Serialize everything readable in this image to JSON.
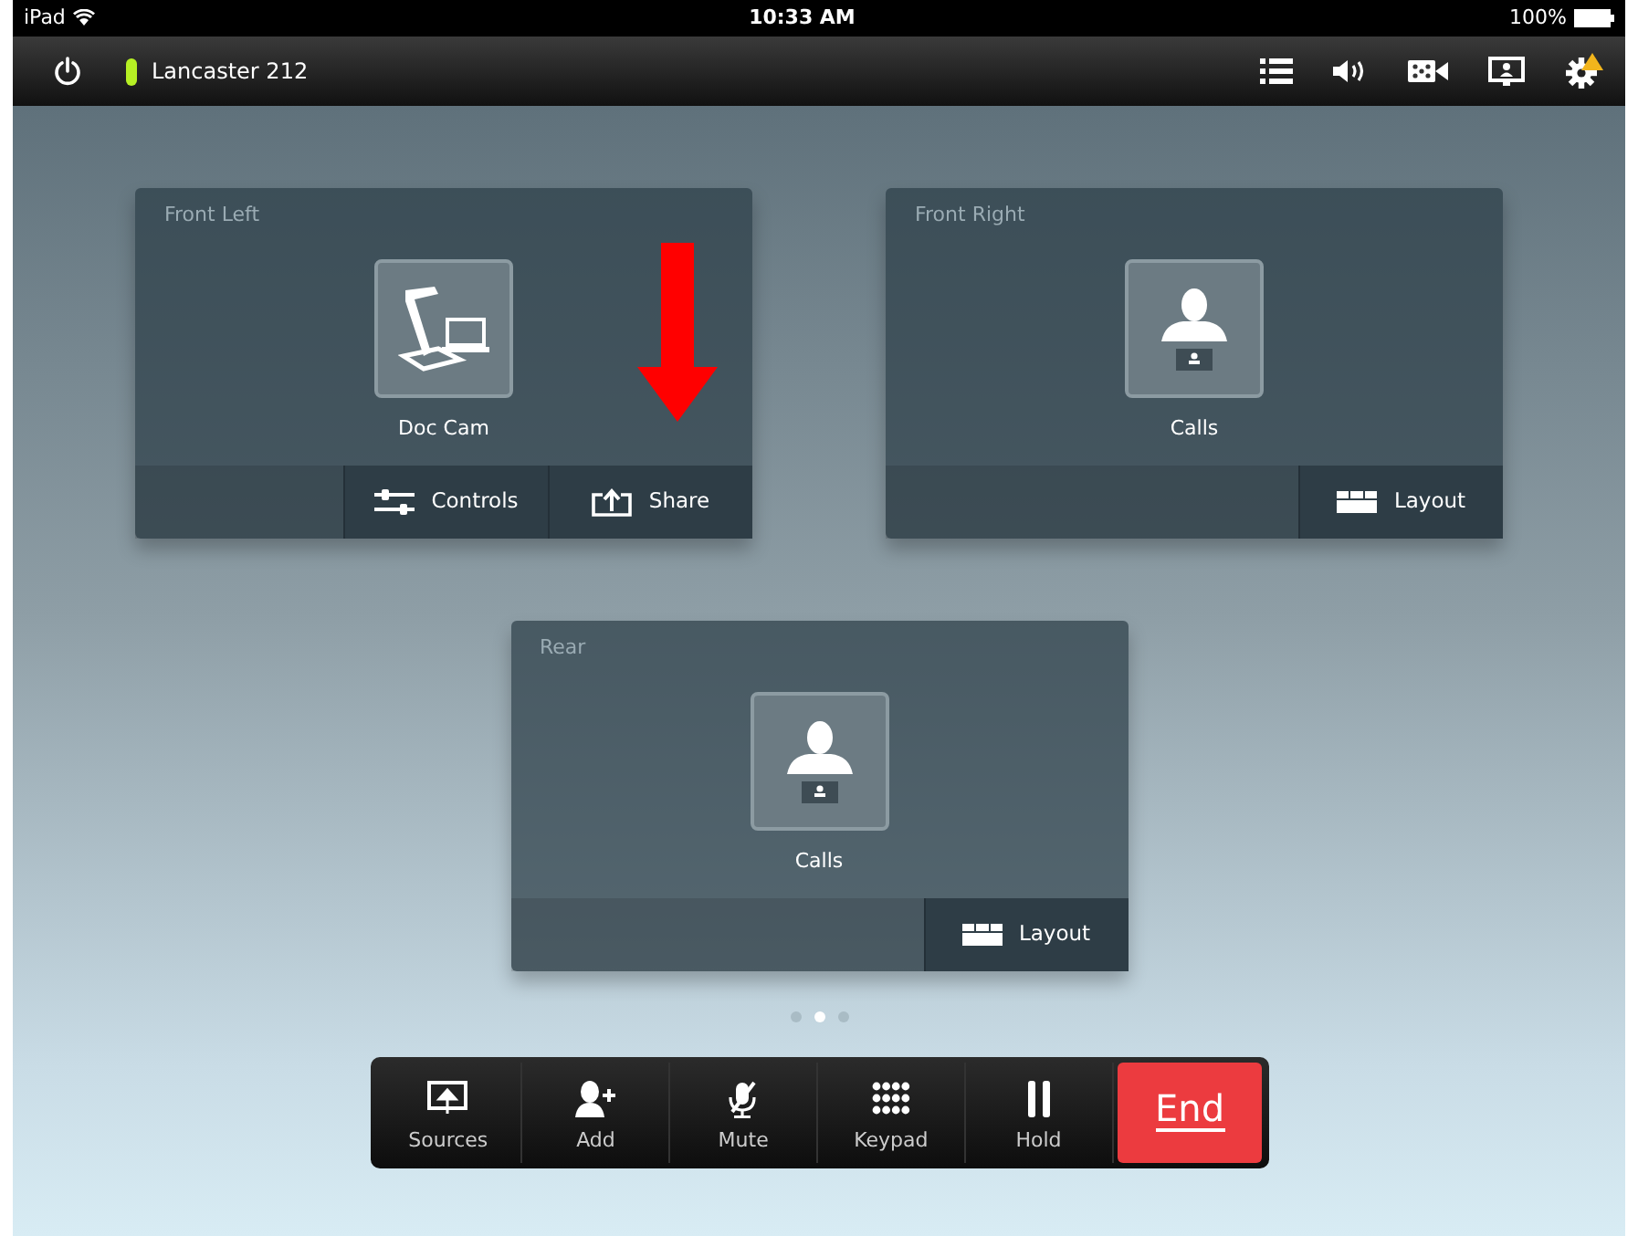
{
  "status_bar": {
    "device": "iPad",
    "time": "10:33 AM",
    "battery": "100%"
  },
  "toolbar": {
    "room": "Lancaster 212",
    "connected": true,
    "settings_warning": true
  },
  "displays": [
    {
      "title": "Front Left",
      "source": "Doc Cam",
      "kind": "doc-cam",
      "actions": [
        {
          "label": "Controls",
          "kind": "controls"
        },
        {
          "label": "Share",
          "kind": "share"
        }
      ]
    },
    {
      "title": "Front Right",
      "source": "Calls",
      "kind": "calls",
      "actions": [
        {
          "label": "Layout",
          "kind": "layout"
        }
      ]
    },
    {
      "title": "Rear",
      "source": "Calls",
      "kind": "calls",
      "actions": [
        {
          "label": "Layout",
          "kind": "layout"
        }
      ]
    }
  ],
  "pages": [
    {
      "selected": false
    },
    {
      "selected": true
    },
    {
      "selected": false
    }
  ],
  "call_controls": [
    {
      "label": "Sources",
      "kind": "sources"
    },
    {
      "label": "Add",
      "kind": "add"
    },
    {
      "label": "Mute",
      "kind": "mute"
    },
    {
      "label": "Keypad",
      "kind": "keypad"
    },
    {
      "label": "Hold",
      "kind": "hold"
    },
    {
      "label": "End",
      "kind": "end"
    }
  ],
  "annotation": {
    "kind": "arrow"
  }
}
